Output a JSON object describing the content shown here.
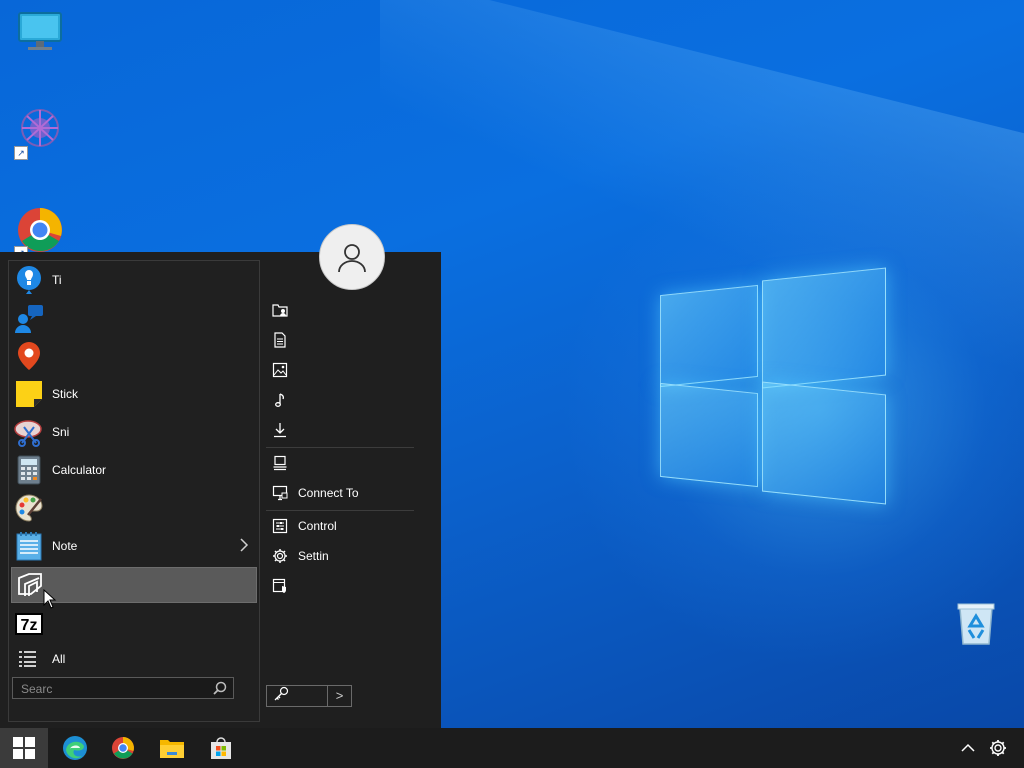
{
  "start_menu": {
    "programs": [
      {
        "name": "tips",
        "label": "Ti",
        "icon": "lightbulb-icon"
      },
      {
        "name": "people",
        "label": "",
        "icon": "people-chat-icon"
      },
      {
        "name": "maps",
        "label": "",
        "icon": "map-pin-icon"
      },
      {
        "name": "sticky-notes",
        "label": "Stick",
        "icon": "sticky-note-icon"
      },
      {
        "name": "snipping-tool",
        "label": "Sni",
        "icon": "scissors-icon"
      },
      {
        "name": "calculator",
        "label": "Calculator",
        "icon": "calculator-icon"
      },
      {
        "name": "paint",
        "label": "",
        "icon": "palette-icon"
      },
      {
        "name": "notepad",
        "label": "Note",
        "icon": "notepad-icon",
        "has_submenu": true
      },
      {
        "name": "remote-app",
        "label": "",
        "icon": "window-stack-icon",
        "highlighted": true
      },
      {
        "name": "7-zip",
        "label": "",
        "icon": "seven-zip-icon",
        "badge_text": "7z"
      }
    ],
    "all_programs_label": "All",
    "search_placeholder": "Searc",
    "right_items": [
      {
        "name": "user-folder",
        "label": "",
        "icon": "user-folder-icon"
      },
      {
        "name": "documents",
        "label": "",
        "icon": "document-icon"
      },
      {
        "name": "pictures",
        "label": "",
        "icon": "picture-icon"
      },
      {
        "name": "music",
        "label": "",
        "icon": "music-note-icon"
      },
      {
        "name": "downloads",
        "label": "",
        "icon": "download-icon"
      },
      {
        "name": "computer",
        "label": "",
        "icon": "computer-icon"
      },
      {
        "name": "connect-to",
        "label": "Connect To",
        "icon": "connect-monitor-icon"
      },
      {
        "name": "control-panel",
        "label": "Control",
        "icon": "control-panel-icon"
      },
      {
        "name": "settings",
        "label": "Settin",
        "icon": "gear-icon"
      },
      {
        "name": "security",
        "label": "",
        "icon": "shield-window-icon"
      }
    ],
    "power_icon": "key-icon",
    "power_arrow": ">"
  },
  "taskbar": {
    "items": [
      {
        "name": "edge",
        "icon": "edge-icon"
      },
      {
        "name": "chrome",
        "icon": "chrome-icon"
      },
      {
        "name": "file-explorer",
        "icon": "folder-icon"
      },
      {
        "name": "store",
        "icon": "store-bag-icon"
      }
    ],
    "tray": [
      "chevron-up-icon",
      "gear-icon"
    ]
  },
  "colors": {
    "menu_bg": "#1f1f1f",
    "highlight": "#5a5a5a",
    "taskbar_bg": "#1c1c1c",
    "desktop_blue": "#0a63d1"
  }
}
